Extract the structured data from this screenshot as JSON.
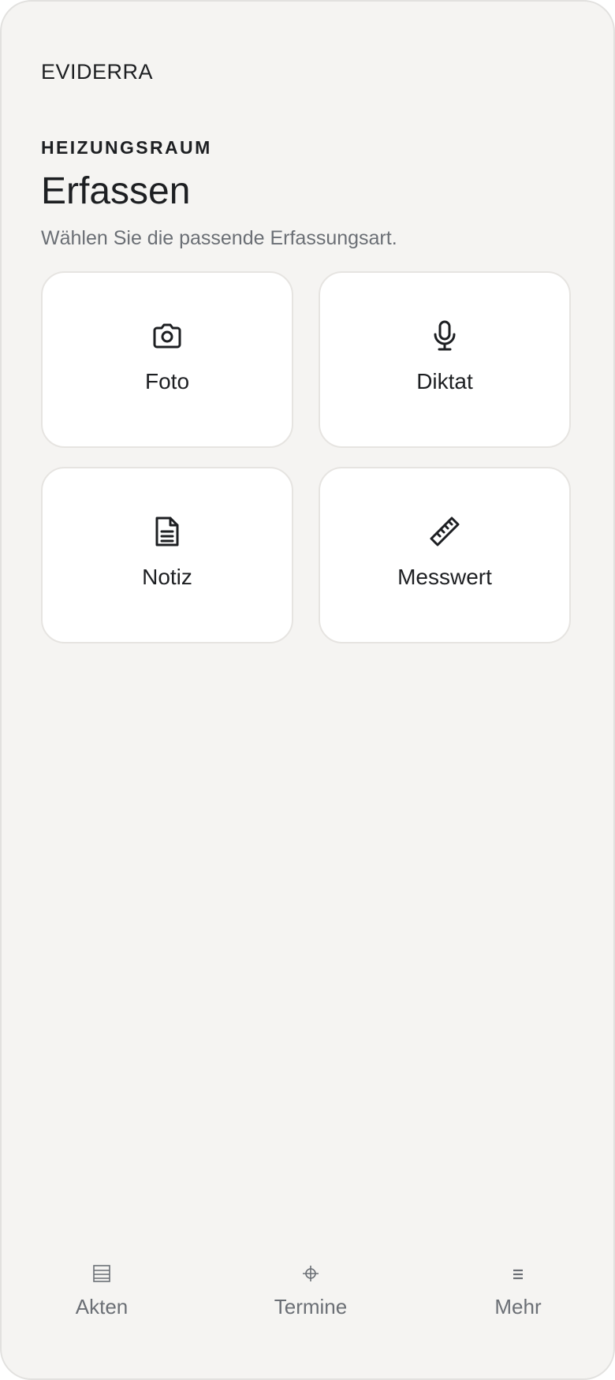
{
  "app": {
    "brand": "EVIDERRA"
  },
  "header": {
    "section_label": "HEIZUNGSRAUM",
    "title": "Erfassen",
    "subtitle": "Wählen Sie die passende Erfassungsart."
  },
  "capture_options": [
    {
      "label": "Foto",
      "icon": "camera-icon"
    },
    {
      "label": "Diktat",
      "icon": "microphone-icon"
    },
    {
      "label": "Notiz",
      "icon": "document-icon"
    },
    {
      "label": "Messwert",
      "icon": "ruler-icon"
    }
  ],
  "tabbar": {
    "items": [
      {
        "label": "Akten",
        "icon": "files-icon"
      },
      {
        "label": "Termine",
        "icon": "crosshair-icon"
      },
      {
        "label": "Mehr",
        "icon": "menu-icon"
      }
    ]
  },
  "colors": {
    "background": "#f5f4f2",
    "card": "#ffffff",
    "text_primary": "#1d1f22",
    "text_secondary": "#6b6f75"
  }
}
